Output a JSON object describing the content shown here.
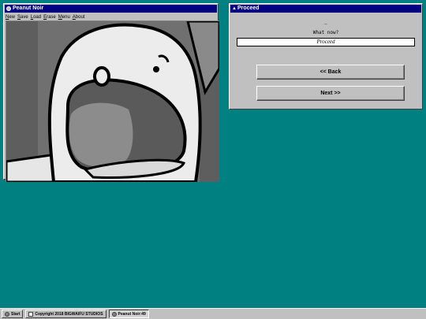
{
  "game_window": {
    "title": "Peanut Noir",
    "menu": [
      "New",
      "Save",
      "Load",
      "Erase",
      "Menu",
      "About"
    ]
  },
  "proceed_window": {
    "title": "Proceed",
    "ellipsis": "..",
    "prompt": "What now?",
    "answer_value": "Proceed",
    "back_label": "<< Back",
    "next_label": "Next >>"
  },
  "taskbar": {
    "start_label": "Start",
    "copyright_label": "Copyright 2018 BIGWAIFU STUDIOS",
    "task_label": "Peanut Noir:49"
  },
  "colors": {
    "desktop": "#008080",
    "titlebar": "#000080",
    "window": "#c0c0c0"
  }
}
